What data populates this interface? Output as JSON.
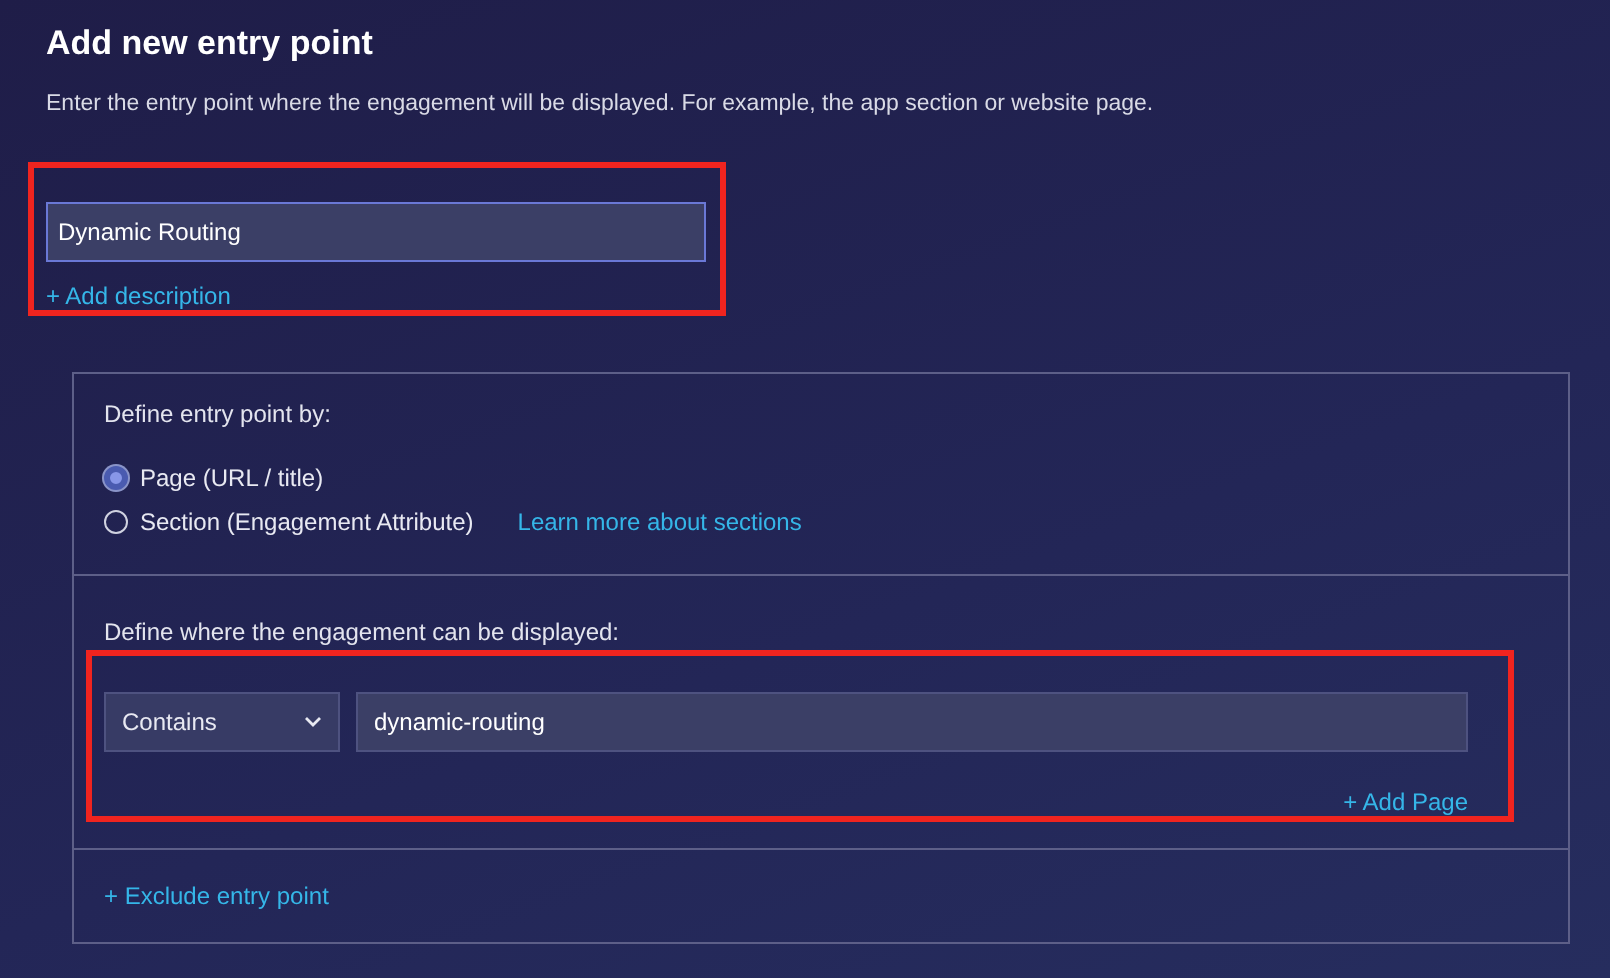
{
  "title": "Add new entry point",
  "description": "Enter the entry point where the engagement will be displayed. For example, the app section or website page.",
  "name_field": {
    "value": "Dynamic Routing",
    "highlighted": true
  },
  "add_description_link": "+ Add description",
  "define_by": {
    "label": "Define entry point by:",
    "options": [
      {
        "label": "Page (URL / title)",
        "selected": true
      },
      {
        "label": "Section (Engagement Attribute)",
        "selected": false
      }
    ],
    "learn_more_link": "Learn more about sections"
  },
  "display": {
    "label": "Define where the engagement can be displayed:",
    "highlighted": true,
    "rules": [
      {
        "operator": "Contains",
        "value": "dynamic-routing"
      }
    ],
    "add_page_link": "+ Add Page"
  },
  "exclude_link": "+ Exclude entry point"
}
